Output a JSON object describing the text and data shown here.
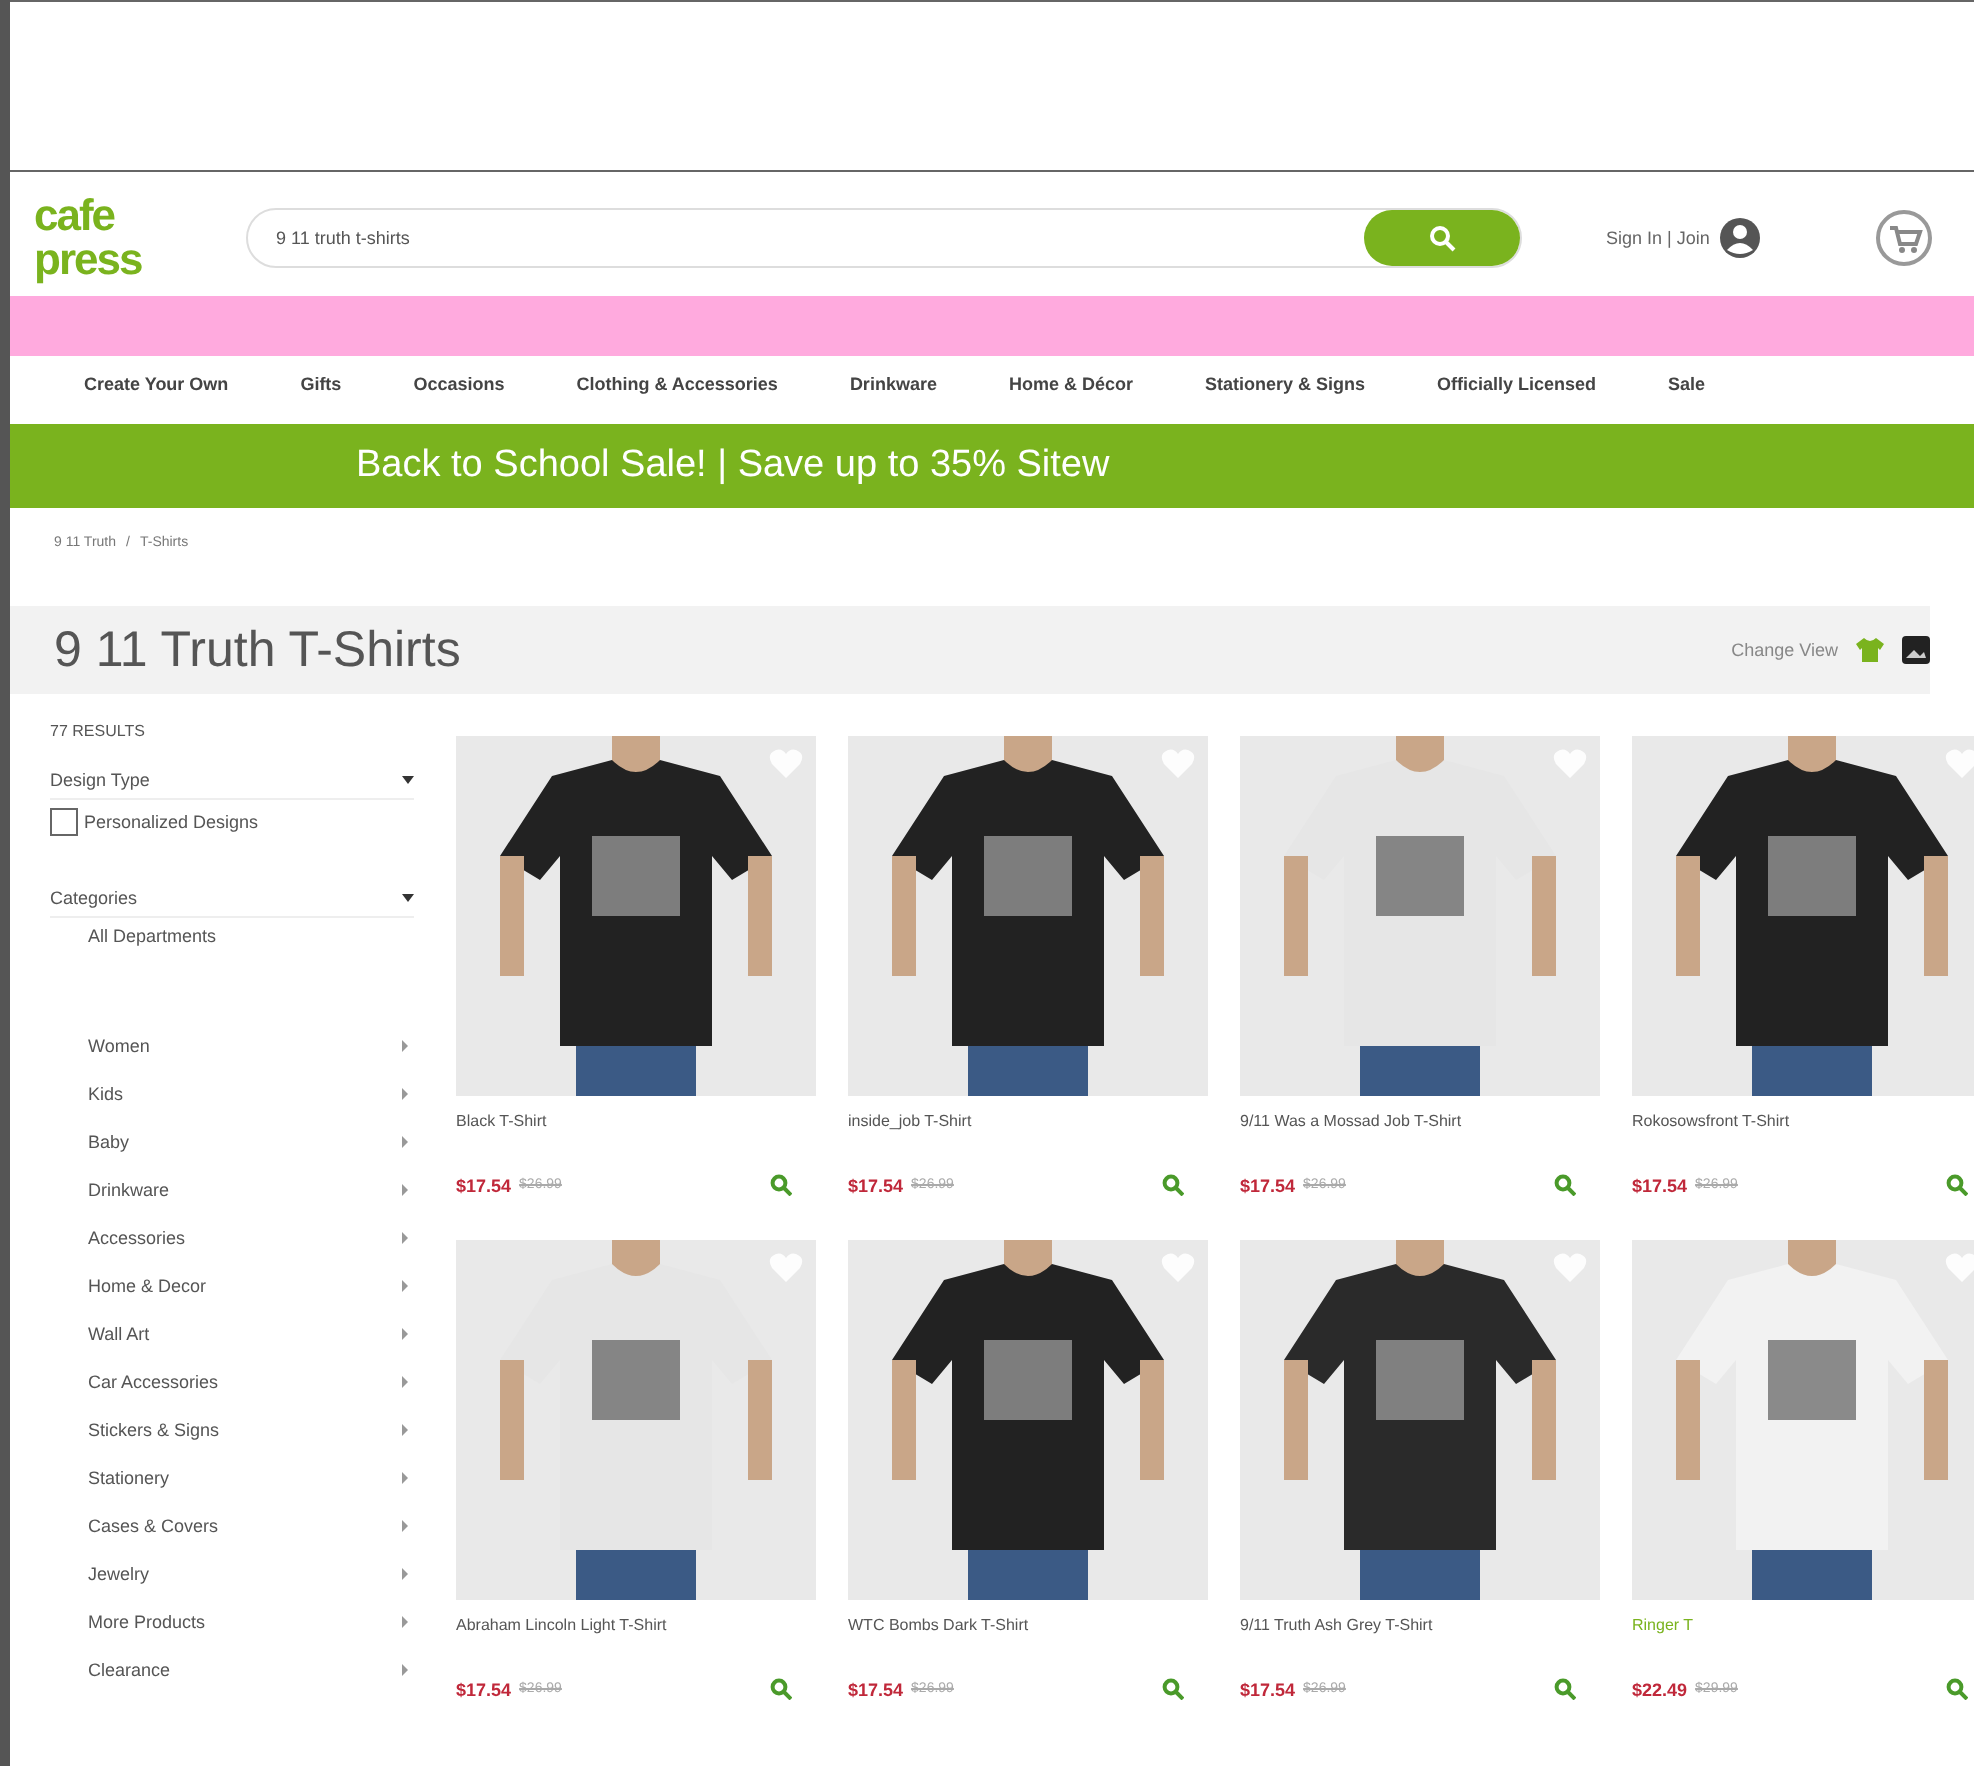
{
  "header": {
    "logo": [
      "cafe",
      "press"
    ],
    "search": {
      "value": "9 11 truth t-shirts"
    },
    "account": "Sign In | Join"
  },
  "nav": [
    "Create Your Own",
    "Gifts",
    "Occasions",
    "Clothing & Accessories",
    "Drinkware",
    "Home & Décor",
    "Stationery & Signs",
    "Officially Licensed",
    "Sale"
  ],
  "banner": "Back to School Sale! | Save up to 35% Sitew",
  "breadcrumb": {
    "items": [
      "9 11 Truth",
      "T-Shirts"
    ],
    "separator": "/"
  },
  "title": "9 11 Truth T-Shirts",
  "change_view": "Change View",
  "sidebar": {
    "results": "77 RESULTS",
    "filters": [
      {
        "label": "Design Type",
        "expanded": true,
        "options": [
          {
            "label": "Personalized Designs",
            "checked": false
          }
        ]
      },
      {
        "label": "Categories",
        "expanded": true
      }
    ],
    "all_departments": "All Departments",
    "categories": [
      "Women",
      "Kids",
      "Baby",
      "Drinkware",
      "Accessories",
      "Home & Decor",
      "Wall Art",
      "Car Accessories",
      "Stickers & Signs",
      "Stationery",
      "Cases & Covers",
      "Jewelry",
      "More Products",
      "Clearance"
    ]
  },
  "products": [
    {
      "name": "Black T-Shirt",
      "price": "$17.54",
      "original_price": "$26.99",
      "featured": false
    },
    {
      "name": "inside_job T-Shirt",
      "price": "$17.54",
      "original_price": "$26.99",
      "featured": false
    },
    {
      "name": "9/11 Was a Mossad Job T-Shirt",
      "price": "$17.54",
      "original_price": "$26.99",
      "featured": false
    },
    {
      "name": "Rokosowsfront T-Shirt",
      "price": "$17.54",
      "original_price": "$26.99",
      "featured": false
    },
    {
      "name": "Abraham Lincoln Light T-Shirt",
      "price": "$17.54",
      "original_price": "$26.99",
      "featured": false
    },
    {
      "name": "WTC Bombs Dark T-Shirt",
      "price": "$17.54",
      "original_price": "$26.99",
      "featured": false
    },
    {
      "name": "9/11 Truth Ash Grey T-Shirt",
      "price": "$17.54",
      "original_price": "$26.99",
      "featured": false
    },
    {
      "name": "Ringer T",
      "price": "$22.49",
      "original_price": "$29.99",
      "featured": true
    }
  ]
}
